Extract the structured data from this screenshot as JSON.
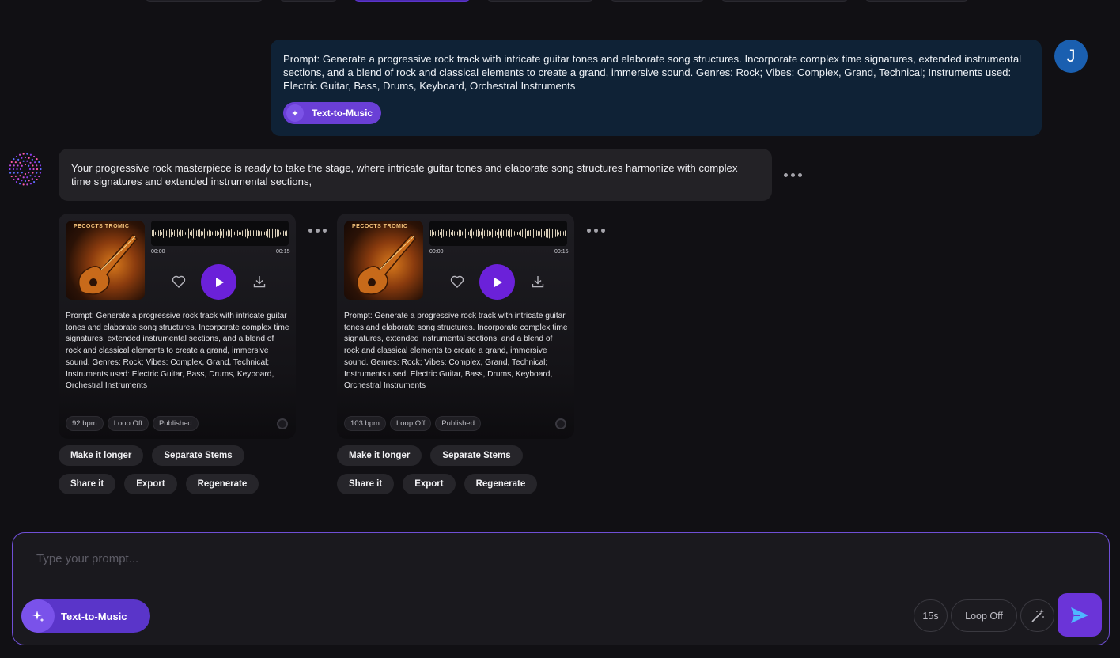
{
  "user": {
    "avatar_initial": "J",
    "prompt": "Prompt: Generate a progressive rock track with intricate guitar tones and elaborate song structures. Incorporate complex time signatures, extended instrumental sections, and a blend of rock and classical elements to create a grand, immersive sound. Genres: Rock; Vibes: Complex, Grand, Technical; Instruments used: Electric Guitar, Bass, Drums, Keyboard, Orchestral Instruments",
    "mode_chip": "Text-to-Music"
  },
  "assistant": {
    "message": "Your progressive rock masterpiece is ready to take the stage, where intricate guitar tones and elaborate song structures harmonize with complex time signatures and extended instrumental sections,"
  },
  "tracks": [
    {
      "cover_title": "PECOCTS TROMIC",
      "time_start": "00:00",
      "time_end": "00:15",
      "prompt": "Prompt: Generate a progressive rock track with intricate guitar tones and elaborate song structures. Incorporate complex time signatures, extended instrumental sections, and a blend of rock and classical elements to create a grand, immersive sound. Genres: Rock; Vibes: Complex, Grand, Technical; Instruments used: Electric Guitar, Bass, Drums, Keyboard, Orchestral Instruments",
      "bpm": "92 bpm",
      "loop": "Loop Off",
      "status": "Published"
    },
    {
      "cover_title": "PECOCTS TROMIC",
      "time_start": "00:00",
      "time_end": "00:15",
      "prompt": "Prompt: Generate a progressive rock track with intricate guitar tones and elaborate song structures. Incorporate complex time signatures, extended instrumental sections, and a blend of rock and classical elements to create a grand, immersive sound. Genres: Rock; Vibes: Complex, Grand, Technical; Instruments used: Electric Guitar, Bass, Drums, Keyboard, Orchestral Instruments",
      "bpm": "103 bpm",
      "loop": "Loop Off",
      "status": "Published"
    }
  ],
  "actions": {
    "make_longer": "Make it longer",
    "separate_stems": "Separate Stems",
    "share": "Share it",
    "export": "Export",
    "regenerate": "Regenerate"
  },
  "composer": {
    "placeholder": "Type your prompt...",
    "mode": "Text-to-Music",
    "duration": "15s",
    "loop": "Loop Off"
  },
  "colors": {
    "accent": "#6b21d9",
    "user_bubble": "#0f2236",
    "bot_bubble": "#232226",
    "composer_border": "#6f4fd6"
  },
  "icons": {
    "mode": "sparkle-icon",
    "like": "heart-icon",
    "play": "play-icon",
    "download": "download-icon",
    "more": "more-dots-icon",
    "enhance": "magic-wand-icon",
    "send": "send-icon"
  }
}
